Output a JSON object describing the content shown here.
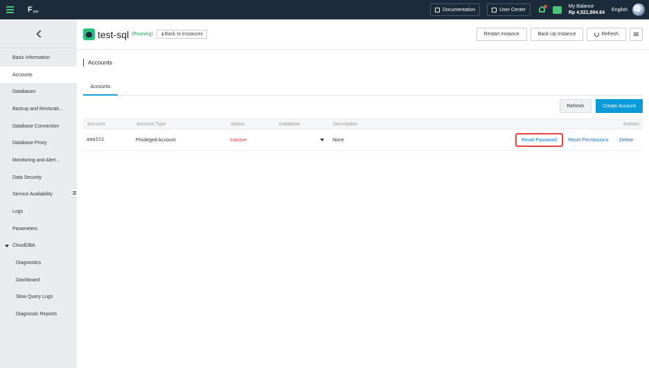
{
  "topbar": {
    "logo_text": "F",
    "logo_sub": "pay",
    "documentation_label": "Documentation",
    "user_center_label": "User Center",
    "balance_label": "My Balance",
    "balance_amount": "Rp 4,521,894.64",
    "language": "English",
    "accent_color": "#4cc27a"
  },
  "sidebar": {
    "items": [
      {
        "label": "Basic Information"
      },
      {
        "label": "Accounts"
      },
      {
        "label": "Databases"
      },
      {
        "label": "Backup and Restorati..."
      },
      {
        "label": "Database Connection"
      },
      {
        "label": "Database Proxy"
      },
      {
        "label": "Monitoring and Alert..."
      },
      {
        "label": "Data Security"
      },
      {
        "label": "Service Availability"
      },
      {
        "label": "Logs"
      },
      {
        "label": "Parameters"
      },
      {
        "label": "CloudDBA"
      },
      {
        "label": "Diagnostics"
      },
      {
        "label": "Dashboard"
      },
      {
        "label": "Slow Query Logs"
      },
      {
        "label": "Diagnostic Reports"
      }
    ]
  },
  "header": {
    "instance_name": "test-sql",
    "status": "(Running)",
    "back_label": "Back to Instances",
    "restart_label": "Restart Instance",
    "backup_label": "Back Up Instance",
    "refresh_label": "Refresh"
  },
  "section": {
    "title": "Accounts",
    "tab_label": "Accounts",
    "refresh_label": "Refresh",
    "create_label": "Create Account"
  },
  "table": {
    "headers": {
      "account": "Account",
      "type": "Account Type",
      "status": "Status",
      "database": "Database",
      "description": "Description",
      "actions": "Actions"
    },
    "rows": [
      {
        "account": "aaa111",
        "type": "Privileged Account",
        "status": "Inactive",
        "database": "",
        "description": "None",
        "reset_password": "Reset Password",
        "reset_permissions": "Reset Permissions",
        "delete": "Delete"
      }
    ]
  }
}
